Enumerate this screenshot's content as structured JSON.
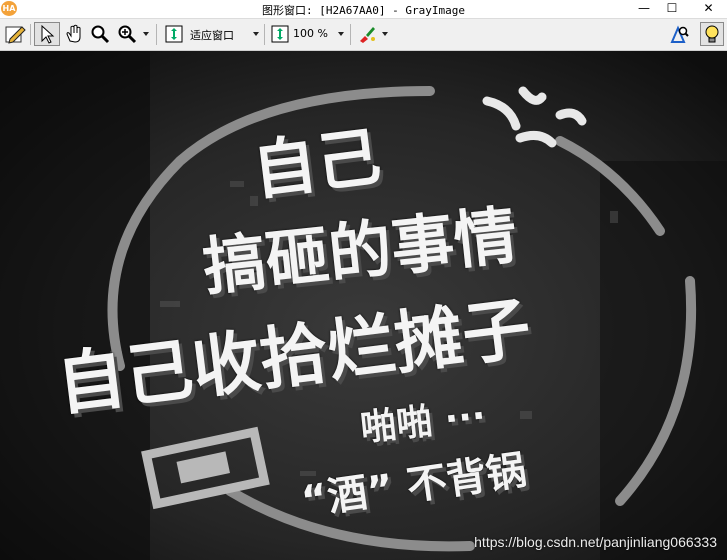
{
  "app": {
    "logo_text": "HA",
    "title": "图形窗口: [H2A67AA0] - GrayImage",
    "minimize_glyph": "—",
    "maximize_glyph": "☐",
    "close_glyph": "✕"
  },
  "toolbar": {
    "zoom_mode_label": "适应窗口",
    "zoom_percent_label": "100 %"
  },
  "image": {
    "lines": [
      "自己",
      "搞砸的事情",
      "自己收拾烂摊子",
      "啪啪 ···",
      "“酒” 不背锅"
    ],
    "watermark": "https://blog.csdn.net/panjinliang066333"
  },
  "colors": {
    "titlebar_bg": "#ffffff",
    "toolbar_bg": "#f0f0f0",
    "canvas_bg": "#181818",
    "text_fill": "#f4f4f4"
  }
}
